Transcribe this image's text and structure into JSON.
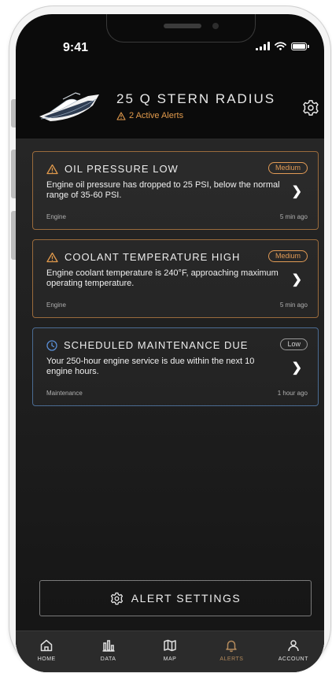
{
  "status_bar": {
    "time": "9:41"
  },
  "header": {
    "boat_name": "25 Q STERN RADIUS",
    "active_alerts": "2 Active Alerts",
    "alert_color": "#e19a4c"
  },
  "alerts": [
    {
      "title": "OIL PRESSURE LOW",
      "severity": "Medium",
      "message": "Engine oil pressure has dropped to 25 PSI, below the normal range of 35-60 PSI.",
      "category": "Engine",
      "time": "5 min ago",
      "icon": "warning-triangle-icon",
      "accent": "#9a6b3c"
    },
    {
      "title": "COOLANT TEMPERATURE HIGH",
      "severity": "Medium",
      "message": "Engine coolant temperature is 240°F, approaching maximum operating temperature.",
      "category": "Engine",
      "time": "5 min ago",
      "icon": "warning-triangle-icon",
      "accent": "#9a6b3c"
    },
    {
      "title": "SCHEDULED MAINTENANCE DUE",
      "severity": "Low",
      "message": "Your 250-hour engine service is due within the next 10 engine hours.",
      "category": "Maintenance",
      "time": "1 hour ago",
      "icon": "clock-icon",
      "accent": "#4b6c93"
    }
  ],
  "alert_settings_label": "ALERT SETTINGS",
  "nav": {
    "items": [
      {
        "label": "HOME",
        "icon": "home-icon"
      },
      {
        "label": "DATA",
        "icon": "bar-chart-icon"
      },
      {
        "label": "MAP",
        "icon": "map-icon"
      },
      {
        "label": "ALERTS",
        "icon": "bell-icon",
        "active": true
      },
      {
        "label": "ACCOUNT",
        "icon": "user-icon"
      }
    ],
    "active_color": "#b38a5c"
  }
}
